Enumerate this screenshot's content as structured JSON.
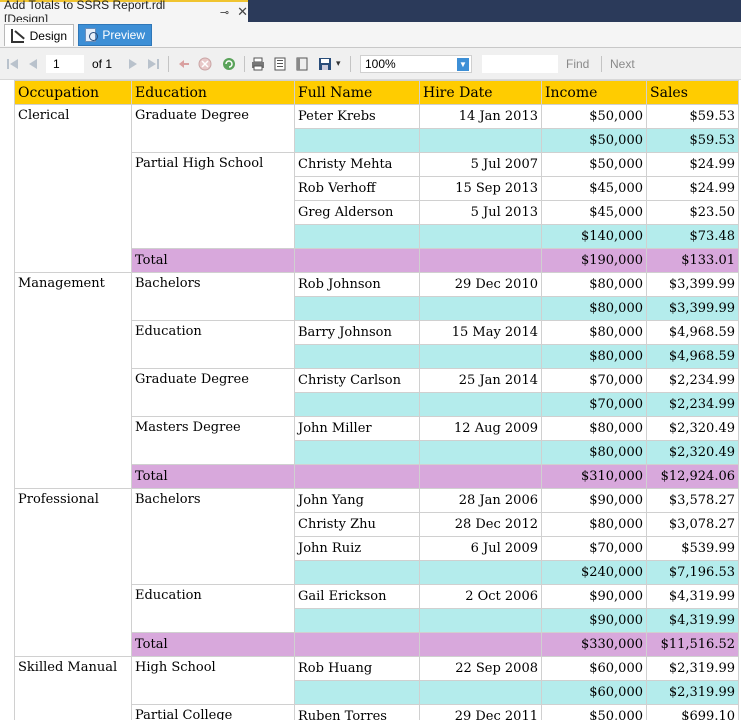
{
  "doc_tab": {
    "title": "Add Totals to SSRS Report.rdl [Design]",
    "pin": "⊸",
    "close": "✕"
  },
  "view_tabs": {
    "design": "Design",
    "preview": "Preview"
  },
  "toolbar": {
    "page": "1",
    "of": "of 1",
    "zoom": "100%",
    "find": "Find",
    "next": "Next"
  },
  "headers": [
    "Occupation",
    "Education",
    "Full Name",
    "Hire Date",
    "Income",
    "Sales"
  ],
  "rows": [
    [
      "Clerical",
      "Graduate Degree",
      "Peter Krebs",
      "14 Jan 2013",
      "$50,000",
      "$59.53"
    ],
    [
      "",
      "",
      "",
      "",
      "$50,000",
      "$59.53"
    ],
    [
      "",
      "Partial High School",
      "Christy Mehta",
      "5 Jul 2007",
      "$50,000",
      "$24.99"
    ],
    [
      "",
      "",
      "Rob Verhoff",
      "15 Sep 2013",
      "$45,000",
      "$24.99"
    ],
    [
      "",
      "",
      "Greg Alderson",
      "5 Jul 2013",
      "$45,000",
      "$23.50"
    ],
    [
      "",
      "",
      "",
      "",
      "$140,000",
      "$73.48"
    ],
    [
      "",
      "Total",
      "",
      "",
      "$190,000",
      "$133.01"
    ],
    [
      "Management",
      "Bachelors",
      "Rob Johnson",
      "29 Dec 2010",
      "$80,000",
      "$3,399.99"
    ],
    [
      "",
      "",
      "",
      "",
      "$80,000",
      "$3,399.99"
    ],
    [
      "",
      "Education",
      "Barry Johnson",
      "15 May 2014",
      "$80,000",
      "$4,968.59"
    ],
    [
      "",
      "",
      "",
      "",
      "$80,000",
      "$4,968.59"
    ],
    [
      "",
      "Graduate Degree",
      "Christy Carlson",
      "25 Jan 2014",
      "$70,000",
      "$2,234.99"
    ],
    [
      "",
      "",
      "",
      "",
      "$70,000",
      "$2,234.99"
    ],
    [
      "",
      "Masters Degree",
      "John Miller",
      "12 Aug 2009",
      "$80,000",
      "$2,320.49"
    ],
    [
      "",
      "",
      "",
      "",
      "$80,000",
      "$2,320.49"
    ],
    [
      "",
      "Total",
      "",
      "",
      "$310,000",
      "$12,924.06"
    ],
    [
      "Professional",
      "Bachelors",
      "John Yang",
      "28 Jan 2006",
      "$90,000",
      "$3,578.27"
    ],
    [
      "",
      "",
      "Christy Zhu",
      "28 Dec 2012",
      "$80,000",
      "$3,078.27"
    ],
    [
      "",
      "",
      "John Ruiz",
      "6 Jul 2009",
      "$70,000",
      "$539.99"
    ],
    [
      "",
      "",
      "",
      "",
      "$240,000",
      "$7,196.53"
    ],
    [
      "",
      "Education",
      "Gail Erickson",
      "2 Oct 2006",
      "$90,000",
      "$4,319.99"
    ],
    [
      "",
      "",
      "",
      "",
      "$90,000",
      "$4,319.99"
    ],
    [
      "",
      "Total",
      "",
      "",
      "$330,000",
      "$11,516.52"
    ],
    [
      "Skilled Manual",
      "High School",
      "Rob Huang",
      "22 Sep 2008",
      "$60,000",
      "$2,319.99"
    ],
    [
      "",
      "",
      "",
      "",
      "$60,000",
      "$2,319.99"
    ],
    [
      "",
      "Partial College",
      "Ruben Torres",
      "29 Dec 2011",
      "$50,000",
      "$699.10"
    ]
  ]
}
